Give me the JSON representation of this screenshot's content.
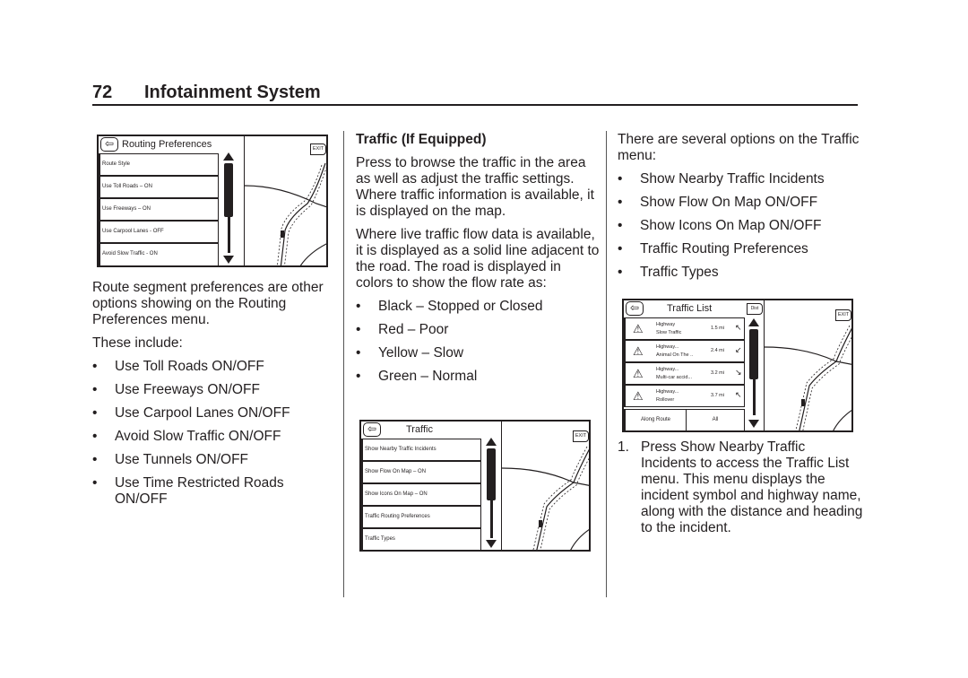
{
  "header": {
    "page_number": "72",
    "section_title": "Infotainment System"
  },
  "column1": {
    "figure": {
      "title": "Routing Preferences",
      "back_icon": "back-arrow-icon",
      "exit_label": "EXIT",
      "menu_items": [
        "Route Style",
        "Use Toll Roads – ON",
        "Use Freeways – ON",
        "Use Carpool Lanes - OFF",
        "Avoid Slow Traffic - ON"
      ]
    },
    "intro": "Route segment preferences are other options showing on the Routing Preferences menu.",
    "these_include": "These include:",
    "bullets": [
      "Use Toll Roads ON/OFF",
      "Use Freeways ON/OFF",
      "Use Carpool Lanes ON/OFF",
      "Avoid Slow Traffic ON/OFF",
      "Use Tunnels ON/OFF",
      "Use Time Restricted Roads ON/OFF"
    ]
  },
  "column2": {
    "heading": "Traffic (If Equipped)",
    "para1": "Press to browse the traffic in the area as well as adjust the traffic settings. Where traffic information is available, it is displayed on the map.",
    "para2": "Where live traffic flow data is available, it is displayed as a solid line adjacent to the road. The road is displayed in colors to show the flow rate as:",
    "bullets": [
      "Black – Stopped or Closed",
      "Red – Poor",
      "Yellow – Slow",
      "Green – Normal"
    ],
    "figure": {
      "title": "Traffic",
      "exit_label": "EXIT",
      "menu_items": [
        "Show Nearby Traffic Incidents",
        "Show Flow On Map – ON",
        "Show Icons On Map – ON",
        "Traffic Routing Preferences",
        "Traffic Types"
      ]
    }
  },
  "column3": {
    "intro": "There are several options on the Traffic menu:",
    "bullets": [
      "Show Nearby Traffic Incidents",
      "Show Flow On Map ON/OFF",
      "Show Icons On Map ON/OFF",
      "Traffic Routing Preferences",
      "Traffic Types"
    ],
    "figure": {
      "title": "Traffic List",
      "dist_label": "Dist",
      "exit_label": "EXIT",
      "incidents": [
        {
          "highway": "Highway",
          "description": "Slow Traffic",
          "distance": "1.5 mi",
          "heading": "↖"
        },
        {
          "highway": "Highway...",
          "description": "Animal On The ..",
          "distance": "2.4 mi",
          "heading": "↙"
        },
        {
          "highway": "Highway...",
          "description": "Multi-car accid...",
          "distance": "3.2 mi",
          "heading": "↘"
        },
        {
          "highway": "Highway...",
          "description": "Rollover",
          "distance": "3.7 mi",
          "heading": "↖"
        }
      ],
      "tabs": [
        "Along Route",
        "All"
      ]
    },
    "step_number": "1.",
    "step_text": "Press Show Nearby Traffic Incidents to access the Traffic List menu. This menu displays the incident symbol and highway name, along with the distance and heading to the incident."
  }
}
